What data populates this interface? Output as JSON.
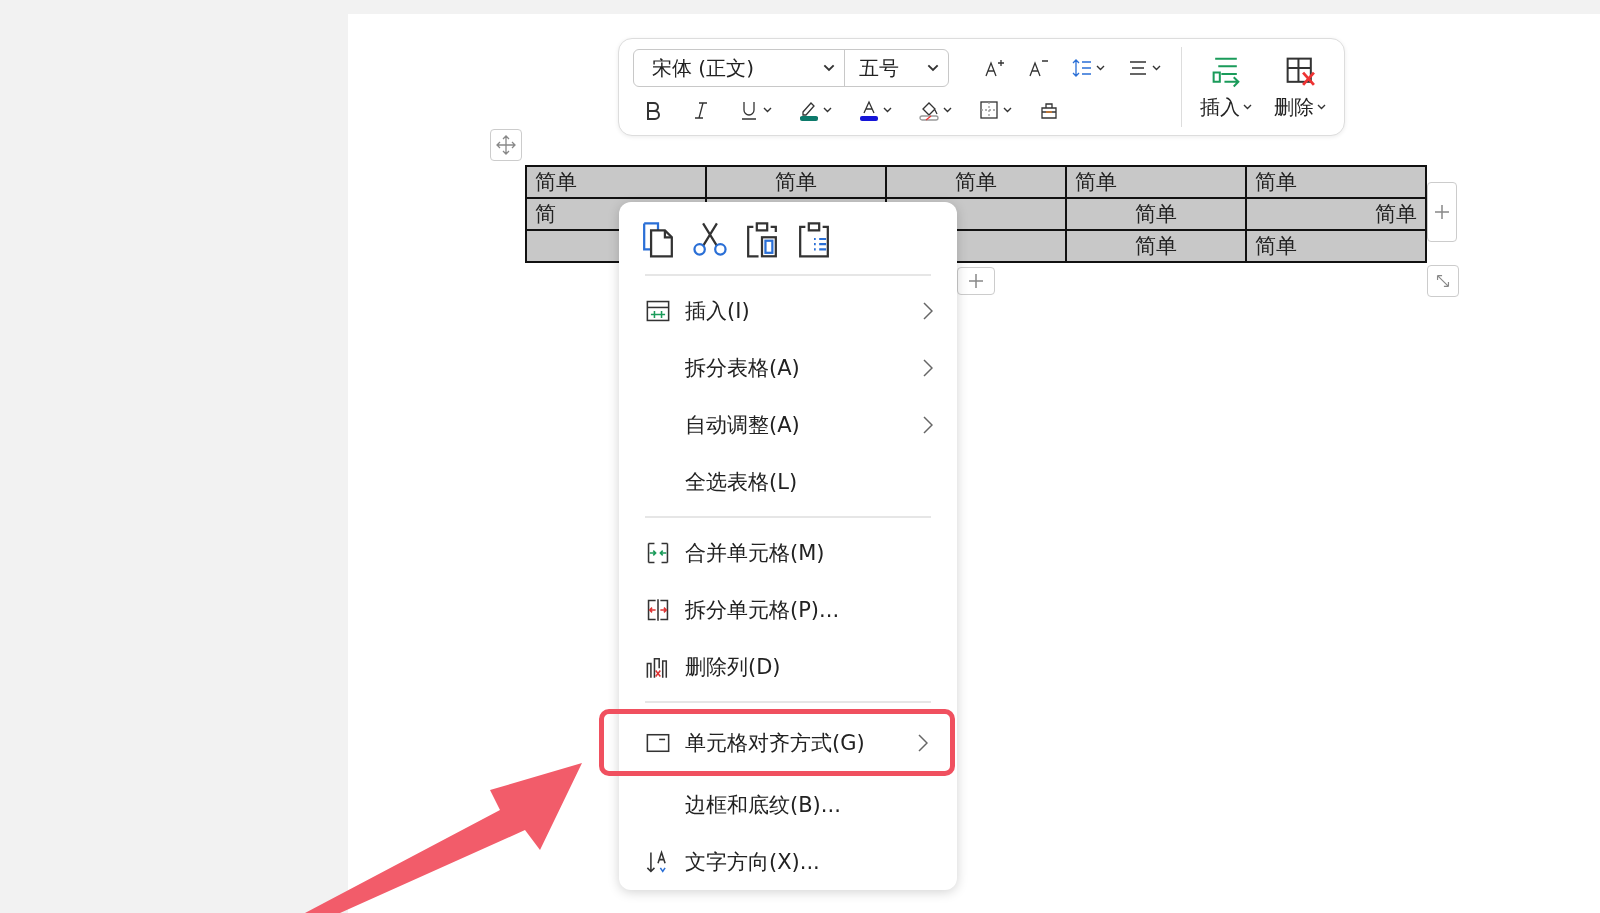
{
  "toolbar": {
    "font_field": {
      "value": "宋体 (正文)"
    },
    "size_field": {
      "value": "五号"
    },
    "insert_button": {
      "label": "插入"
    },
    "delete_button": {
      "label": "删除"
    }
  },
  "table": {
    "rows": [
      [
        {
          "text": "简单"
        },
        {
          "text": "简单"
        },
        {
          "text": "简单"
        },
        {
          "text": "简单"
        },
        {
          "text": "简单"
        }
      ],
      [
        {
          "text": "简"
        },
        {},
        {},
        {
          "text": "简单"
        },
        {
          "text": "简单"
        }
      ],
      [
        {},
        {},
        {},
        {
          "text": "简单"
        },
        {
          "text": "简单"
        }
      ]
    ]
  },
  "context_menu": {
    "groups": [
      {
        "items": [
          {
            "label": "插入(I)",
            "submenu": true,
            "highlighted": false
          },
          {
            "label": "拆分表格(A)",
            "submenu": true,
            "highlighted": false
          },
          {
            "label": "自动调整(A)",
            "submenu": true,
            "highlighted": false
          },
          {
            "label": "全选表格(L)",
            "submenu": false,
            "highlighted": false
          }
        ]
      },
      {
        "items": [
          {
            "label": "合并单元格(M)",
            "submenu": false,
            "highlighted": false
          },
          {
            "label": "拆分单元格(P)...",
            "submenu": false,
            "highlighted": false
          },
          {
            "label": "删除列(D)",
            "submenu": false,
            "highlighted": false
          }
        ]
      },
      {
        "items": [
          {
            "label": "单元格对齐方式(G)",
            "submenu": true,
            "highlighted": true
          },
          {
            "label": "边框和底纹(B)...",
            "submenu": false,
            "highlighted": false
          },
          {
            "label": "文字方向(X)...",
            "submenu": false,
            "highlighted": false
          }
        ]
      }
    ]
  }
}
